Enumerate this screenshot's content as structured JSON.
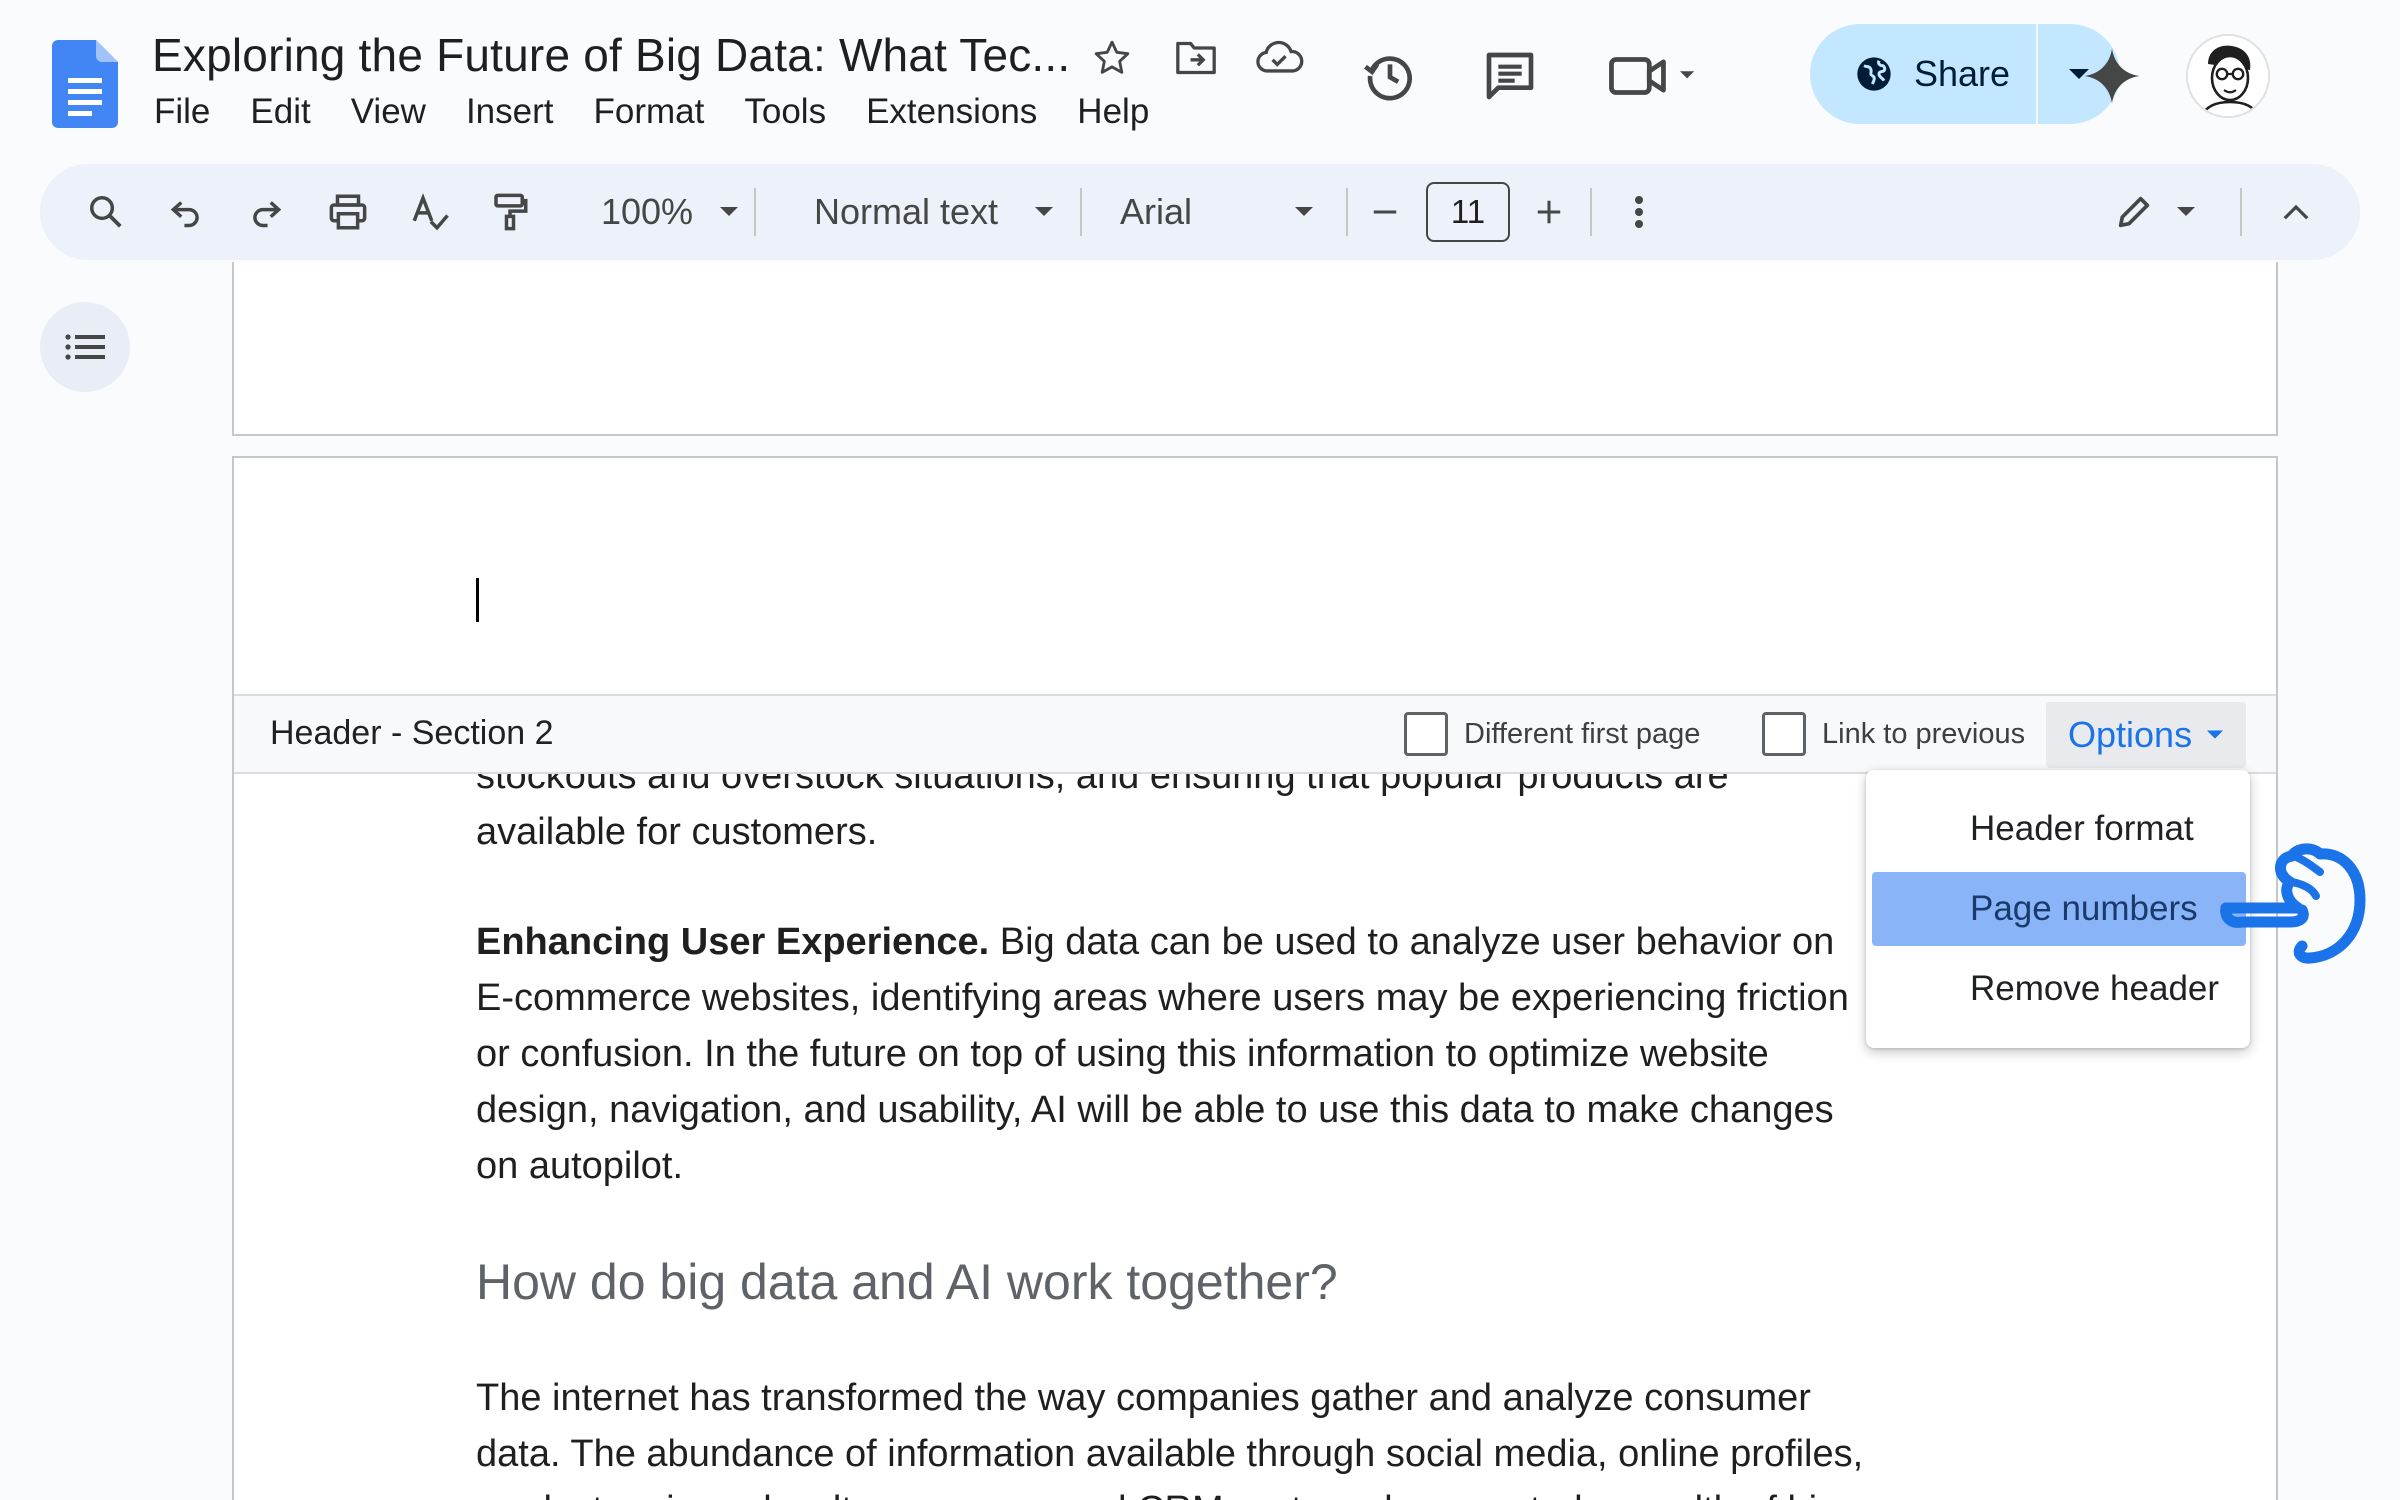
{
  "doc": {
    "title": "Exploring the Future of Big Data: What Tec...",
    "menu": [
      "File",
      "Edit",
      "View",
      "Insert",
      "Format",
      "Tools",
      "Extensions",
      "Help"
    ]
  },
  "share": {
    "label": "Share"
  },
  "toolbar": {
    "zoom": "100%",
    "style": "Normal text",
    "font": "Arial",
    "font_size": "11"
  },
  "header_bar": {
    "title": "Header - Section 2",
    "different_first_page": "Different first page",
    "link_to_previous": "Link to previous",
    "options": "Options"
  },
  "options_menu": {
    "items": [
      "Header format",
      "Page numbers",
      "Remove header"
    ],
    "selected": "Page numbers"
  },
  "body": {
    "p1_line1": "stockouts and overstock situations, and ensuring that popular products are",
    "p1_line2": "available for customers.",
    "p2_bold": "Enhancing User Experience.",
    "p2_line1": " Big data can be used to analyze user behavior on",
    "p2_line2": "E-commerce websites, identifying areas where users may be experiencing friction",
    "p2_line3": "or confusion. In the future on top of using this information to optimize website",
    "p2_line4": "design, navigation, and usability, AI will be able to use this data to make changes",
    "p2_line5": "on autopilot.",
    "heading": "How do big data and AI work together?",
    "p3_line1": "The internet has transformed the way companies gather and analyze consumer",
    "p3_line2": "data. The abundance of information available through social media, online profiles,",
    "p3_line3": "product reviews, loyalty programs, and CRM systems has created a wealth of big"
  },
  "icons": {
    "title_icons": [
      "star-icon",
      "move-to-folder-icon",
      "cloud-saved-icon"
    ],
    "header_icons": [
      "version-history-icon",
      "comments-icon",
      "meet-icon",
      "gemini-icon"
    ],
    "toolbar_icons": [
      "search-icon",
      "undo-icon",
      "redo-icon",
      "print-icon",
      "spellcheck-icon",
      "paint-format-icon",
      "more-vert-icon",
      "edit-mode-icon",
      "collapse-icon"
    ]
  },
  "colors": {
    "share_bg": "#c2e7ff",
    "toolbar_bg": "#edf2fa",
    "selected_item": "#8ab4f8",
    "options_text": "#1a73e8"
  }
}
